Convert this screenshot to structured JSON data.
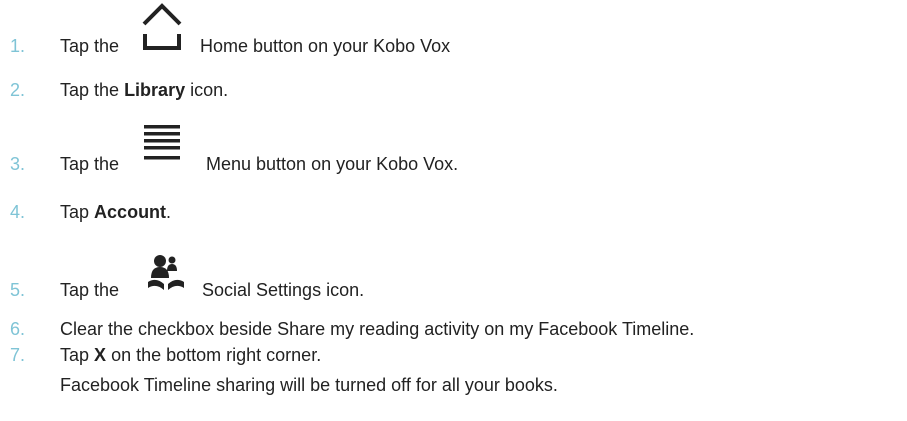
{
  "steps": [
    {
      "num": "1.",
      "pre": "Tap the",
      "icon": "home-icon",
      "post": "Home button on your Kobo Vox"
    },
    {
      "num": "2.",
      "pre": "Tap the",
      "bold": "Library",
      "post": "icon."
    },
    {
      "num": "3.",
      "pre": "Tap the",
      "icon": "menu-icon",
      "post": "Menu button on your Kobo Vox."
    },
    {
      "num": "4.",
      "pre": "Tap",
      "bold": "Account",
      "post": "."
    },
    {
      "num": "5.",
      "pre": "Tap the",
      "icon": "social-settings-icon",
      "post": "Social Settings icon."
    },
    {
      "num": "6.",
      "text": "Clear the checkbox beside Share my reading activity on my Facebook Timeline."
    },
    {
      "num": "7.",
      "pre": "Tap",
      "bold": "X",
      "post": "on the bottom right corner."
    }
  ],
  "note": "Facebook Timeline sharing will be turned off for all your books.",
  "colors": {
    "number": "#7fc4d6",
    "text": "#222222",
    "icon": "#222222"
  }
}
